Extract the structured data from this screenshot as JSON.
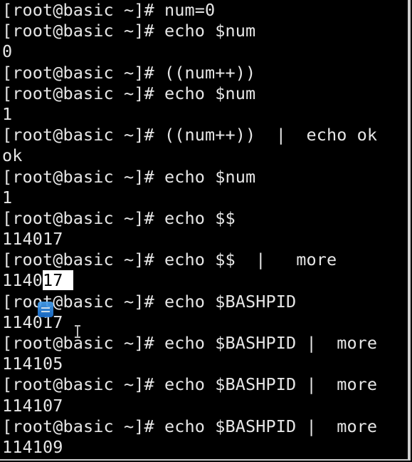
{
  "terminal": {
    "lines": [
      "[root@basic ~]# num=0",
      "[root@basic ~]# echo $num",
      "0",
      "[root@basic ~]# ((num++))",
      "[root@basic ~]# echo $num",
      "1",
      "[root@basic ~]# ((num++))  |  echo ok",
      "ok",
      "[root@basic ~]# echo $num",
      "1",
      "[root@basic ~]# echo $$",
      "114017",
      "[root@basic ~]# echo $$  |   more"
    ],
    "selected_line": {
      "unselected_part": "1140",
      "selected_part": "17 "
    },
    "lines_after": [
      "[root@basic ~]# echo $BASHPID",
      "114017",
      "[root@basic ~]# echo $BASHPID |  more",
      "114105",
      "[root@basic ~]# echo $BASHPID |  more",
      "114107",
      "[root@basic ~]# echo $BASHPID |  more",
      "114109"
    ],
    "colors": {
      "background": "#000000",
      "foreground": "#e6e6e6",
      "selection_background": "#ffffff",
      "selection_foreground": "#000000"
    },
    "overlay_icons": [
      "drag-handle-icon",
      "text-cursor-icon"
    ]
  }
}
